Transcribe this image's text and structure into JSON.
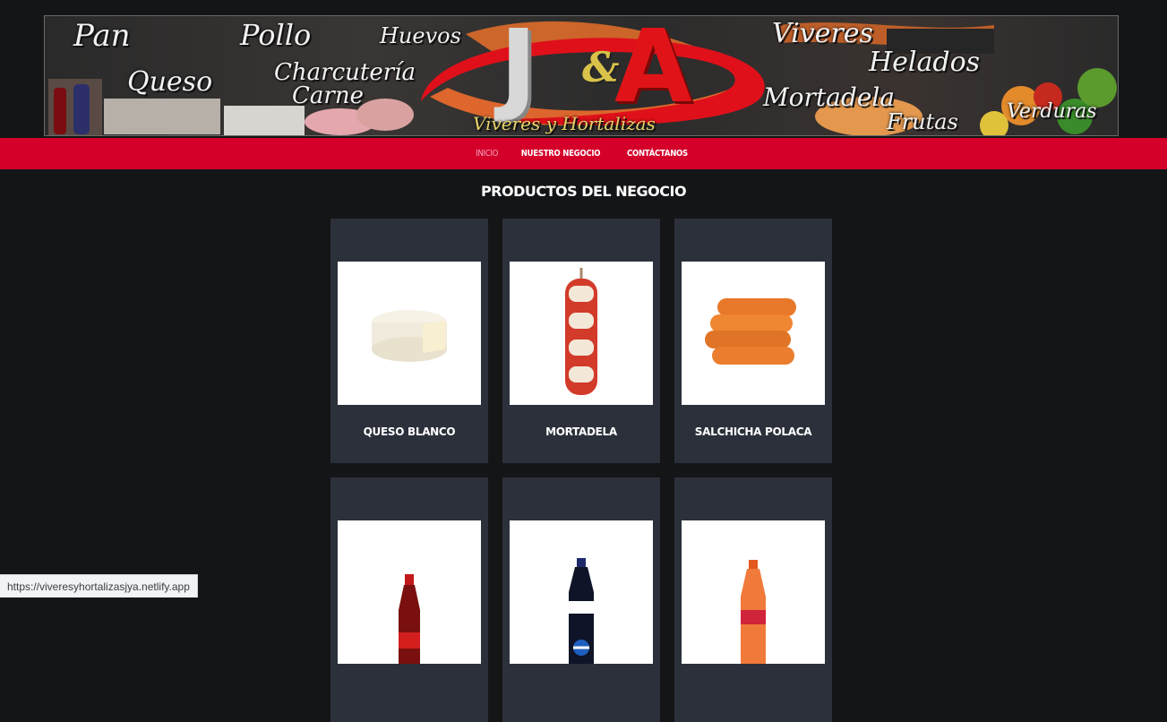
{
  "banner": {
    "words": [
      "Pan",
      "Pollo",
      "Huevos",
      "Queso",
      "Charcutería",
      "Carne",
      "Viveres",
      "Helados",
      "Mortadela",
      "Frutas",
      "Verduras"
    ],
    "logo_left": "J",
    "logo_amp": "&",
    "logo_right": "A",
    "tagline": "Viveres y Hortalizas"
  },
  "nav": {
    "items": [
      {
        "label": "Inicio",
        "active": true
      },
      {
        "label": "Nuestro negocio",
        "active": false
      },
      {
        "label": "Contáctanos",
        "active": false
      }
    ]
  },
  "section": {
    "title": "Productos del negocio"
  },
  "products": [
    {
      "name": "Queso Blanco",
      "image": "cheese-wheel"
    },
    {
      "name": "Mortadela",
      "image": "mortadela-roll"
    },
    {
      "name": "Salchicha Polaca",
      "image": "sausages"
    },
    {
      "name": "",
      "image": "coca-cola-bottle"
    },
    {
      "name": "",
      "image": "pepsi-bottle"
    },
    {
      "name": "",
      "image": "orange-soda-bottle"
    }
  ],
  "status_bar": {
    "url": "https://viveresyhortalizasjya.netlify.app"
  },
  "colors": {
    "nav": "#d4002a",
    "background": "#141517",
    "card": "#2c303b",
    "active_link": "#f3a8bb"
  }
}
